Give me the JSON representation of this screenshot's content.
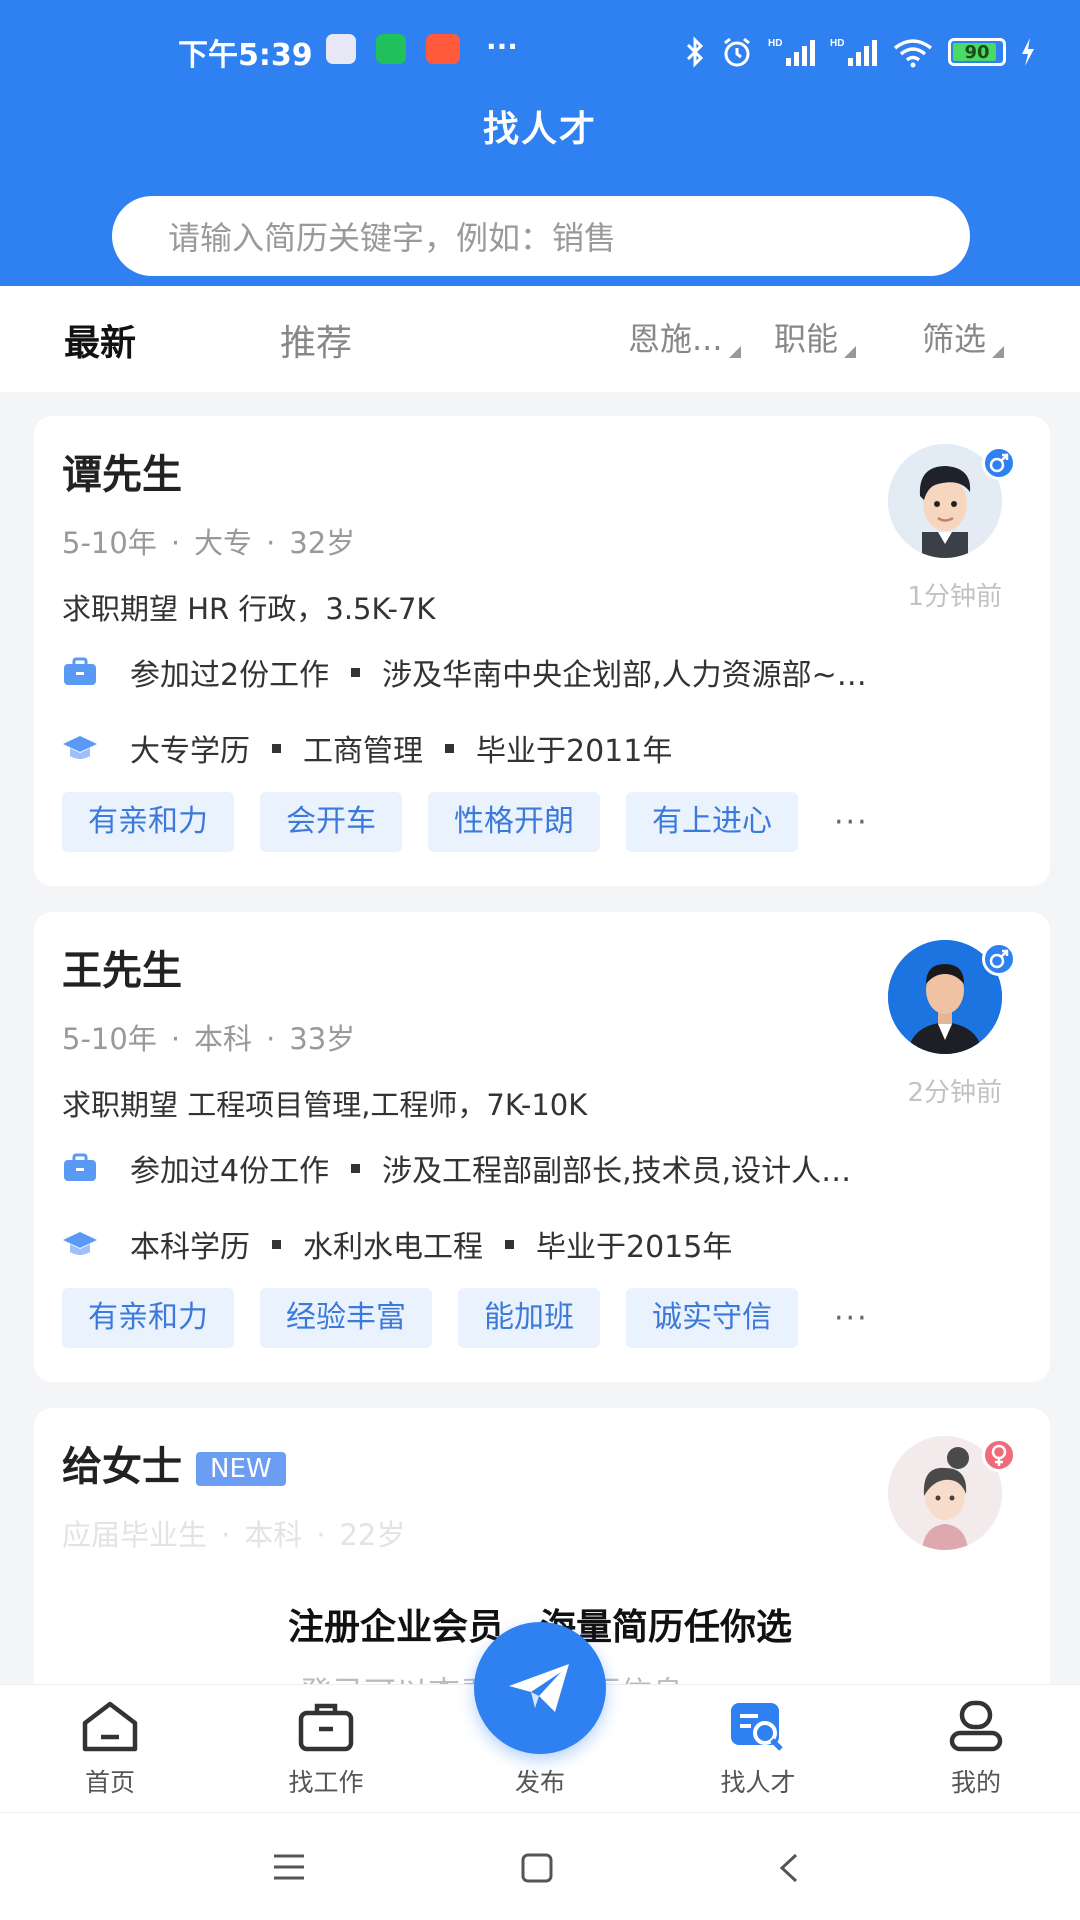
{
  "status_bar": {
    "time": "下午5:39",
    "more": "···",
    "battery": "90"
  },
  "header": {
    "title": "找人才"
  },
  "search": {
    "placeholder": "请输入简历关键字，例如：销售"
  },
  "tabs": {
    "active": "最新",
    "other": "推荐",
    "filters": [
      "恩施...",
      "职能",
      "筛选"
    ]
  },
  "cards": [
    {
      "name": "谭先生",
      "meta": [
        "5-10年",
        "大专",
        "32岁"
      ],
      "time_ago": "1分钟前",
      "expect": "求职期望 HR 行政，3.5K-7K",
      "work": [
        "参加过2份工作",
        "涉及华南中央企划部,人力资源部~…"
      ],
      "edu": [
        "大专学历",
        "工商管理",
        "毕业于2011年"
      ],
      "tags": [
        "有亲和力",
        "会开车",
        "性格开朗",
        "有上进心"
      ],
      "more": "···",
      "gender": "male"
    },
    {
      "name": "王先生",
      "meta": [
        "5-10年",
        "本科",
        "33岁"
      ],
      "time_ago": "2分钟前",
      "expect": "求职期望 工程项目管理,工程师，7K-10K",
      "work": [
        "参加过4份工作",
        "涉及工程部副部长,技术员,设计人…"
      ],
      "edu": [
        "本科学历",
        "水利水电工程",
        "毕业于2015年"
      ],
      "tags": [
        "有亲和力",
        "经验丰富",
        "能加班",
        "诚实守信"
      ],
      "more": "···",
      "gender": "male"
    },
    {
      "name": "给女士",
      "badge": "NEW",
      "meta": [
        "应届毕业生",
        "本科",
        "22岁"
      ],
      "gender": "female"
    }
  ],
  "promo": {
    "title": "注册企业会员，海量简历任你选",
    "subtitle": "登录可以查看更多简历信息"
  },
  "bottom_nav": [
    {
      "label": "首页",
      "icon": "home-icon"
    },
    {
      "label": "找工作",
      "icon": "briefcase-icon"
    },
    {
      "label": "发布",
      "icon": "paper-plane-icon"
    },
    {
      "label": "找人才",
      "icon": "talent-search-icon",
      "active": true
    },
    {
      "label": "我的",
      "icon": "user-icon"
    }
  ],
  "colors": {
    "primary": "#2f80f0",
    "tag_bg": "#eaf2fe",
    "tag_text": "#3c7ad9",
    "male": "#2f80f0",
    "female": "#f06a7a"
  }
}
